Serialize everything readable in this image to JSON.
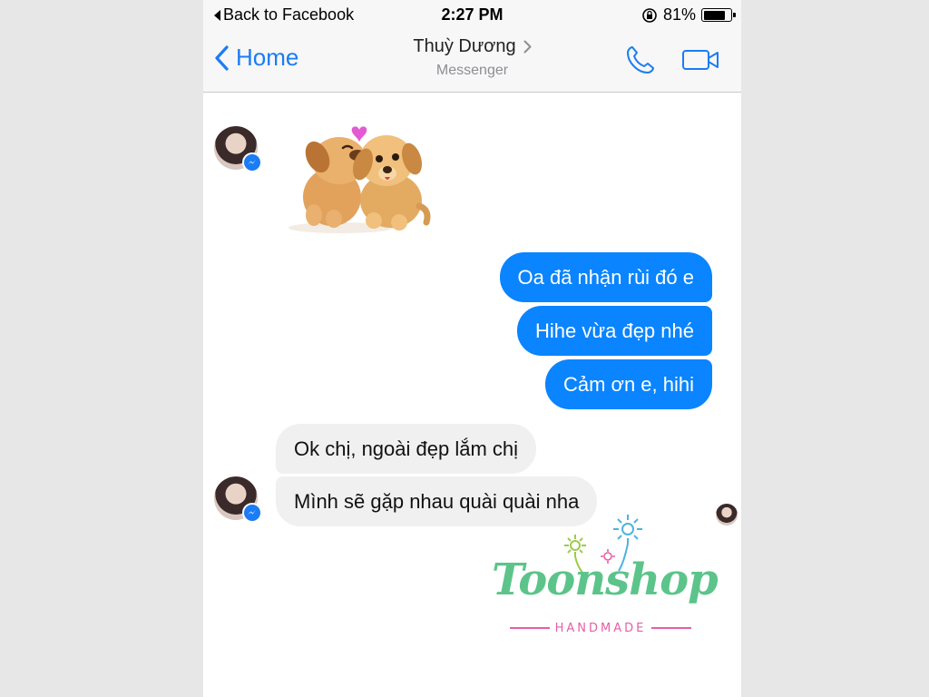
{
  "status_bar": {
    "back_label": "Back to Facebook",
    "time": "2:27 PM",
    "battery_text": "81%",
    "battery_level": 0.81
  },
  "nav": {
    "back_label": "Home",
    "contact_name": "Thuỳ Dương",
    "subtitle": "Messenger",
    "icons": [
      "chevron-left-icon",
      "chevron-right-icon",
      "phone-icon",
      "video-icon"
    ],
    "accent_color": "#1b7cf5"
  },
  "messages": [
    {
      "from": "contact",
      "type": "sticker",
      "sticker": "two-puppies-kissing-sticker"
    },
    {
      "from": "me",
      "text": "Oa đã nhận rùi đó e"
    },
    {
      "from": "me",
      "text": "Hihe vừa đẹp nhé"
    },
    {
      "from": "me",
      "text": "Cảm ơn e, hihi"
    },
    {
      "from": "contact",
      "text": "Ok chị, ngoài đẹp lắm chị"
    },
    {
      "from": "contact",
      "text": "Mình sẽ gặp nhau quài quài nha"
    }
  ],
  "watermark": {
    "logo_text": "Toonshop",
    "tagline": "HANDMADE",
    "colors": {
      "logo": "#5cc48a",
      "tagline": "#e55ea7"
    }
  },
  "colors": {
    "outgoing_bubble": "#0a84ff",
    "incoming_bubble": "#f1f0f0",
    "bar_background": "#f7f7f7"
  }
}
